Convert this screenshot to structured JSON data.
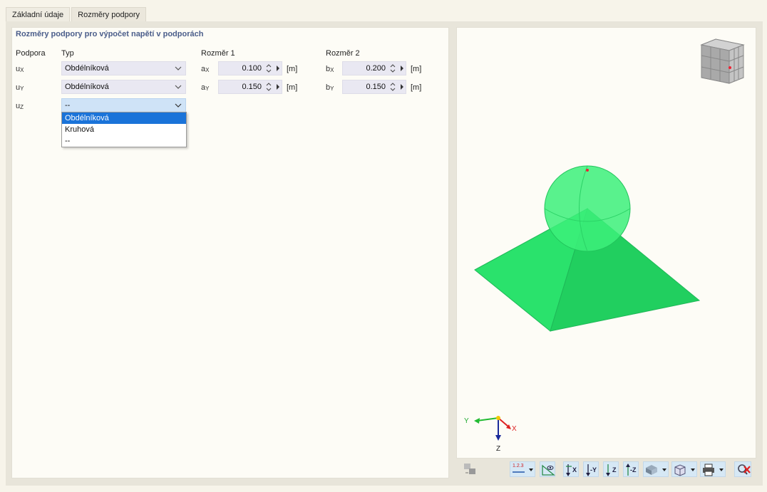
{
  "tabs": [
    {
      "label": "Základní údaje"
    },
    {
      "label": "Rozměry podpory"
    }
  ],
  "section_title": "Rozměry podpory pro výpočet napětí v podporách",
  "headers": {
    "support": "Podpora",
    "type": "Typ",
    "dim1": "Rozměr 1",
    "dim2": "Rozměr 2"
  },
  "rows": [
    {
      "support": "u",
      "support_sub": "X",
      "type": "Obdélníková",
      "dim1_label": "a",
      "dim1_sub": "X",
      "dim1_value": "0.100",
      "dim1_unit": "[m]",
      "dim2_label": "b",
      "dim2_sub": "X",
      "dim2_value": "0.200",
      "dim2_unit": "[m]"
    },
    {
      "support": "u",
      "support_sub": "Y",
      "type": "Obdélníková",
      "dim1_label": "a",
      "dim1_sub": "Y",
      "dim1_value": "0.150",
      "dim1_unit": "[m]",
      "dim2_label": "b",
      "dim2_sub": "Y",
      "dim2_value": "0.150",
      "dim2_unit": "[m]"
    },
    {
      "support": "u",
      "support_sub": "Z",
      "type": "--"
    }
  ],
  "dropdown_options": [
    "Obdélníková",
    "Kruhová",
    "--"
  ],
  "dropdown_selected_index": 0,
  "axes": {
    "x": "X",
    "y": "Y",
    "z": "Z"
  },
  "toolbar": {
    "numbering_label": "1.2.3",
    "view_x": "X",
    "view_neg_y": "-Y",
    "view_z": "Z",
    "view_neg_z": "-Z"
  },
  "colors": {
    "accent": "#1a73d9",
    "model_green": "#22dd66",
    "title_blue": "#4a5d8a",
    "toolbar_btn": "#d6e8f5"
  },
  "icons": [
    "view-cube-icon",
    "axis-triad-icon",
    "reset-view-icon",
    "numbering-icon",
    "show-hide-icon",
    "view-x-icon",
    "view-neg-y-icon",
    "view-z-icon",
    "view-neg-z-icon",
    "display-mode-icon",
    "model-view-icon",
    "print-icon",
    "close-view-icon"
  ]
}
